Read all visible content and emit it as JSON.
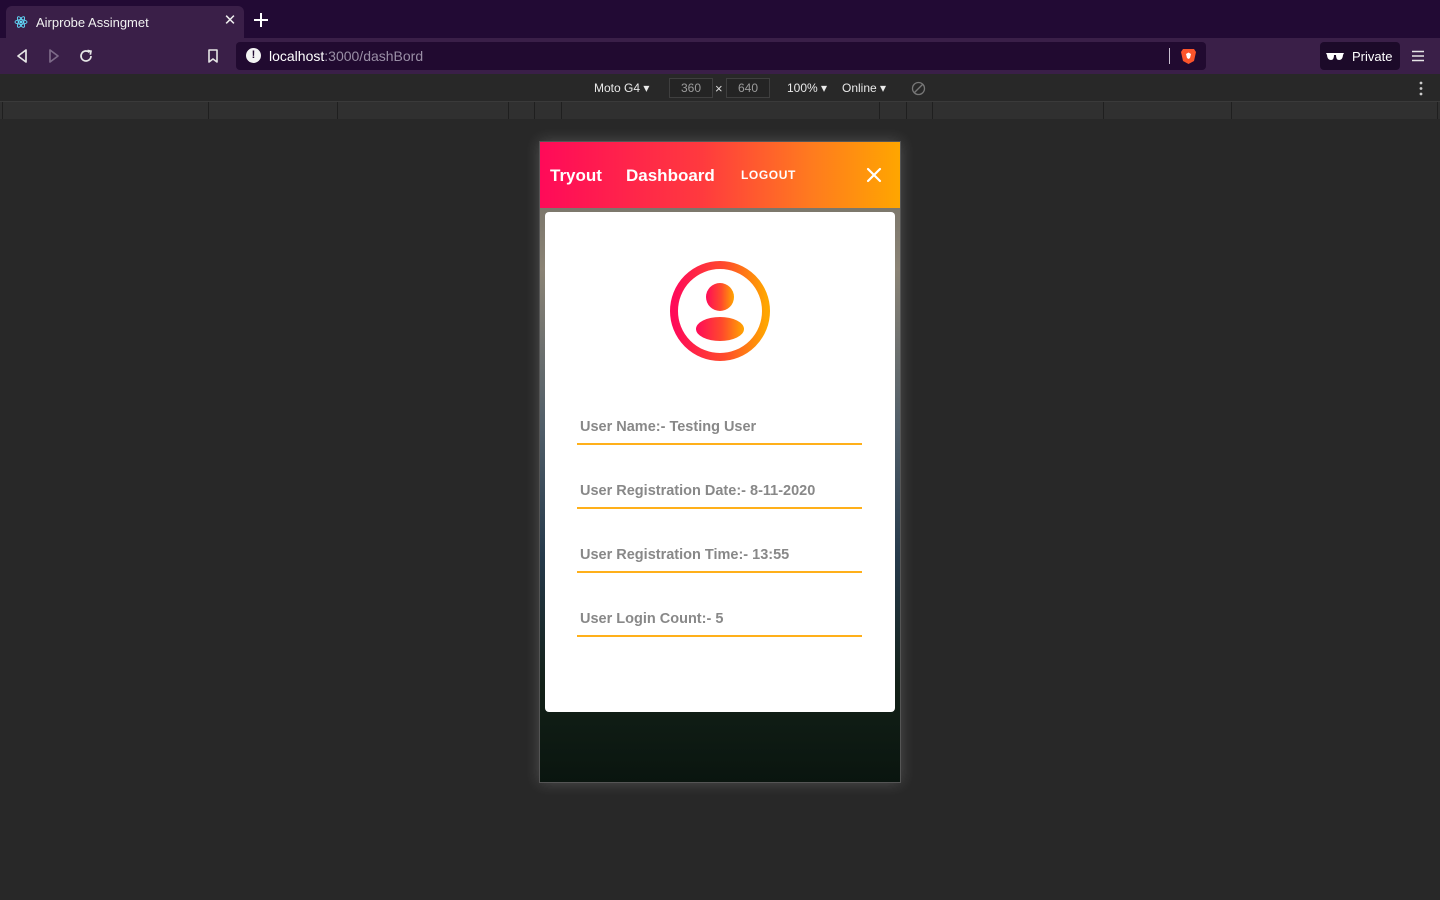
{
  "browser": {
    "tab_title": "Airprobe Assingmet",
    "url_host": "localhost",
    "url_path": ":3000/dashBord",
    "private_label": "Private"
  },
  "devtools": {
    "device": "Moto G4",
    "width": "360",
    "height": "640",
    "times": "×",
    "zoom": "100%",
    "network": "Online"
  },
  "app": {
    "brand": "Tryout",
    "nav_dashboard": "Dashboard",
    "logout": "LOGOUT",
    "fields": [
      "User Name:- Testing User",
      "User Registration Date:- 8-11-2020",
      "User Registration Time:- 13:55",
      "User Login Count:- 5"
    ],
    "colors": {
      "gradient_start": "#ff0a59",
      "gradient_end": "#ffa600",
      "underline": "#ffb01a"
    }
  }
}
